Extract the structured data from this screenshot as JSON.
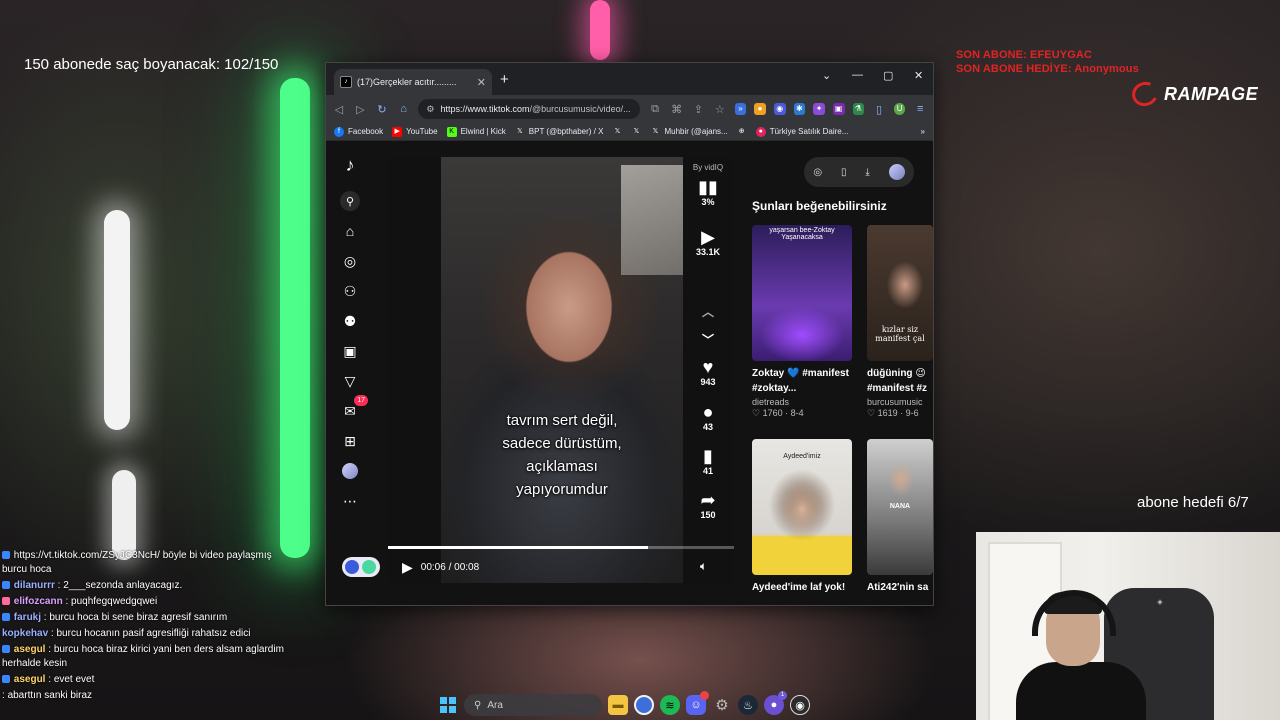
{
  "overlay": {
    "subscriber_goal": "150 abonede saç boyanacak: 102/150",
    "last_sub": "SON ABONE: EFEUYGAC",
    "last_gift_sub": "SON ABONE HEDİYE: Anonymous",
    "brand": "RAMPAGE",
    "sub_target": "abone hedefi 6/7"
  },
  "chat": [
    {
      "user": "",
      "message": "https://vt.tiktok.com/ZSyJC3NcH/ böyle bi video paylaşmış burcu hoca",
      "user_color": "#ffffff"
    },
    {
      "user": "dilanurrr",
      "message": "2___sezonda anlayacagız.",
      "user_color": "#9ab0ff"
    },
    {
      "user": "elifozcann",
      "message": "puqhfegqwedgqwei",
      "user_color": "#d9a0ff"
    },
    {
      "user": "farukj",
      "message": "burcu hoca bi sene biraz agresif sanırım",
      "user_color": "#9ab0ff"
    },
    {
      "user": "kopkehav",
      "message": "burcu hocanın pasif agresifliği rahatsız edici",
      "user_color": "#9ab0ff"
    },
    {
      "user": "asegul",
      "message": "burcu hoca biraz kirici yani ben ders alsam aglardim herhalde kesin",
      "user_color": "#ffd36b"
    },
    {
      "user": "asegul",
      "message": "evet evet",
      "user_color": "#ffd36b"
    },
    {
      "user": "",
      "message": "abarttın sanki biraz",
      "user_color": "#ffffff"
    }
  ],
  "taskbar": {
    "search_placeholder": "Ara",
    "icons": [
      "windows-start-icon",
      "search-icon",
      "file-explorer-icon",
      "chrome-icon",
      "spotify-icon",
      "discord-icon",
      "settings-icon",
      "steam-icon",
      "app-icon",
      "obs-icon"
    ],
    "steam_badge": "1"
  },
  "browser": {
    "tab_title": "(17)Gerçekler acıtır.........",
    "url_host": "https://www.tiktok.com",
    "url_path": "/@burcusumusic/video/...",
    "bookmarks": [
      "Facebook",
      "YouTube",
      "Elwind | Kick",
      "BPT (@bpthaber) / X",
      "",
      "",
      "Muhbir (@ajans...",
      "",
      "Türkiye Satılık Daire..."
    ]
  },
  "tiktok": {
    "notifications_badge": "17",
    "vidiq_label": "By vidIQ",
    "vidiq_percent": "3%",
    "plays": "33.1K",
    "likes": "943",
    "comments": "43",
    "saves": "41",
    "shares": "150",
    "caption_lines": [
      "tavrım sert değil,",
      "sadece dürüstüm,",
      "açıklaması",
      "yapıyorumdur"
    ],
    "time": "00:06 / 00:08",
    "progress": 0.75,
    "suggest_title": "Şunları beğenebilirsiniz",
    "cards": [
      {
        "title": "Zoktay 💙 #manifest\n#zoktay...",
        "author": "dietreads",
        "likes": "1760",
        "date": "8-4",
        "overlay": "yaşarsan bee-Zoktay\nYaşanacaksa"
      },
      {
        "title": "düğüning 😉\n#manifest #z",
        "author": "burcusumusic",
        "likes": "1619",
        "date": "9-6",
        "overlay": "kızlar siz\nmanifest çal"
      },
      {
        "title": "Aydeed'ime laf yok!",
        "author": "",
        "likes": "",
        "date": "",
        "overlay": "Aydeed'imiz"
      },
      {
        "title": "Ati242'nin sa",
        "author": "",
        "likes": "",
        "date": "",
        "overlay": "NANA"
      }
    ]
  }
}
